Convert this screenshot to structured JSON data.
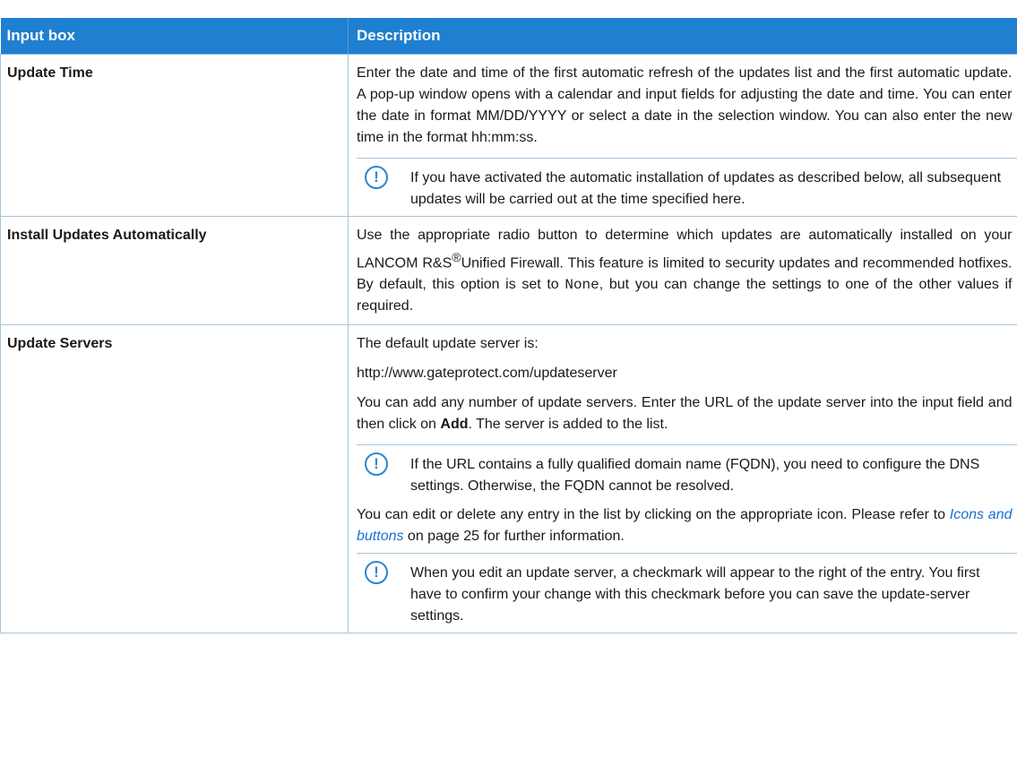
{
  "header": {
    "col1": "Input box",
    "col2": "Description"
  },
  "rows": {
    "update_time": {
      "label": "Update Time",
      "p1": "Enter the date and time of the first automatic refresh of the updates list and the first automatic update. A pop-up window opens with a calendar and input fields for adjusting the date and time. You can enter the date in format MM/DD/YYYY or select a date in the selection window. You can also enter the new time in the format hh:mm:ss.",
      "note": "If you have activated the automatic installation of updates as described below, all subsequent updates will be carried out at the time specified here."
    },
    "install": {
      "label": "Install Updates Automatically",
      "p1a": "Use the appropriate radio button to determine which updates are automatically installed on your LANCOM R&S",
      "reg": "®",
      "p1b": "Unified Firewall. This feature is limited to security updates and recommended hotfixes. By default, this option is set to ",
      "code": "None",
      "p1c": ", but you can change the settings to one of the other values if required."
    },
    "servers": {
      "label": "Update Servers",
      "p1": "The default update server is:",
      "p2": "http://www.gateprotect.com/updateserver",
      "p3a": "You can add any number of update servers. Enter the URL of the update server into the input field and then click on ",
      "p3b": "Add",
      "p3c": ". The server is added to the list.",
      "note1": "If the URL contains a fully qualified domain name (FQDN), you need to configure the DNS settings. Otherwise, the FQDN cannot be resolved.",
      "p4a": "You can edit or delete any entry in the list by clicking on the appropriate icon. Please refer to ",
      "link": "Icons and buttons",
      "p4b": " on page 25 for further information.",
      "note2": "When you edit an update server, a checkmark will appear to the right of the entry. You first have to confirm your change with this checkmark before you can save the update-server settings."
    }
  },
  "icons": {
    "note": "exclamation-circle-icon",
    "glyph": "!"
  }
}
